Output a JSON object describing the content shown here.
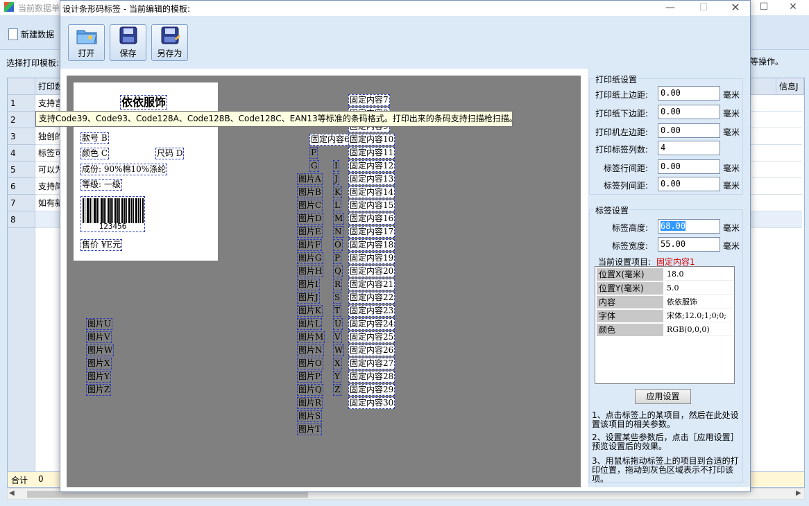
{
  "main": {
    "title": "当前数据单",
    "new_button": "新建数据",
    "select_template": "选择打印模板:",
    "right_hint": "等操作。",
    "columns": [
      "打印数",
      "信息J"
    ],
    "rows": [
      {
        "num": "1",
        "text": "支持言"
      },
      {
        "num": "2",
        "text": "支持"
      },
      {
        "num": "3",
        "text": "独创的"
      },
      {
        "num": "4",
        "text": "标签可"
      },
      {
        "num": "5",
        "text": "可以为"
      },
      {
        "num": "6",
        "text": "支持简"
      },
      {
        "num": "7",
        "text": "如有新"
      },
      {
        "num": "8",
        "text": ""
      }
    ],
    "total_label": "合计",
    "total_value": "0"
  },
  "dialog": {
    "title": "设计条形码标签 - 当前编辑的模板:",
    "toolbar": {
      "open": "打开",
      "save": "保存",
      "save_as": "另存为"
    },
    "tooltip": "支持Code39、Code93、Code128A、Code128B、Code128C、EAN13等标准的条码格式。打印出来的条码支持扫描枪扫描。",
    "label": {
      "title": "依依服饰",
      "style": "款号 B",
      "color": "颜色 C",
      "size": "尺码 D",
      "composition": "成份: 90%棉10%涤纶",
      "grade": "等级: 一级",
      "barcode_value": "123456",
      "price": "售价 ¥E元"
    },
    "left_pictures": [
      "图片U",
      "图片V",
      "图片W",
      "图片X",
      "图片Y",
      "图片Z"
    ],
    "mid_pictures": [
      "图片A",
      "图片B",
      "图片C",
      "图片D",
      "图片E",
      "图片F",
      "图片G",
      "图片H",
      "图片I",
      "图片J",
      "图片K",
      "图片L",
      "图片M",
      "图片N",
      "图片O",
      "图片P",
      "图片Q",
      "图片R",
      "图片S",
      "图片T"
    ],
    "single_letters": [
      "E",
      "F",
      "G"
    ],
    "col_letters": [
      "I",
      "J",
      "K",
      "L",
      "M",
      "N",
      "O",
      "P",
      "Q",
      "R",
      "S",
      "T",
      "U",
      "V",
      "W",
      "X",
      "Y",
      "Z"
    ],
    "fixed_items": [
      "固定内容7",
      "固定内容8",
      "固定内容9",
      "固定内容10",
      "固定内容11",
      "固定内容12",
      "固定内容13",
      "固定内容14",
      "固定内容15",
      "固定内容16",
      "固定内容17",
      "固定内容18",
      "固定内容19",
      "固定内容20",
      "固定内容21",
      "固定内容22",
      "固定内容23",
      "固定内容24",
      "固定内容25",
      "固定内容26",
      "固定内容27",
      "固定内容28",
      "固定内容29",
      "固定内容30"
    ],
    "extra_fixed": [
      "固定内容6"
    ],
    "paper": {
      "group_title": "打印纸设置",
      "top_margin_label": "打印纸上边距:",
      "top_margin": "0.00",
      "bottom_margin_label": "打印纸下边距:",
      "bottom_margin": "0.00",
      "left_margin_label": "打印机左边距:",
      "left_margin": "0.00",
      "columns_label": "打印标签列数:",
      "columns": "4",
      "row_gap_label": "标签行间距:",
      "row_gap": "0.00",
      "col_gap_label": "标签列间距:",
      "col_gap": "0.00",
      "unit": "毫米"
    },
    "label_settings": {
      "group_title": "标签设置",
      "height_label": "标签高度:",
      "height": "68.00",
      "width_label": "标签宽度:",
      "width": "55.00",
      "current_label": "当前设置项目:",
      "current_item": "固定内容1",
      "properties": [
        {
          "key": "位置X(毫米)",
          "value": "18.0"
        },
        {
          "key": "位置Y(毫米)",
          "value": "5.0"
        },
        {
          "key": "内容",
          "value": "依依服饰"
        },
        {
          "key": "字体",
          "value": "宋体;12.0;1;0;0;"
        },
        {
          "key": "颜色",
          "value": "RGB(0,0,0)"
        }
      ],
      "apply_button": "应用设置",
      "help": [
        "1、点击标签上的某项目，然后在此处设置该项目的相关参数。",
        "2、设置某些参数后，点击［应用设置］预览设置后的效果。",
        "3、用鼠标拖动标签上的项目到合适的打印位置，拖动到灰色区域表示不打印该项。"
      ]
    },
    "accent_color": "#d40000"
  }
}
